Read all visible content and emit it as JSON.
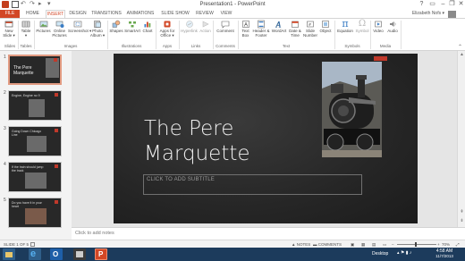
{
  "window": {
    "title": "Presentation1 - PowerPoint",
    "help": "?",
    "minimize": "–",
    "maximize": "❐",
    "close": "✕"
  },
  "quick_access": {
    "undo": "↶",
    "redo": "↷",
    "start": "▸",
    "customize": "▾"
  },
  "tabs": [
    "FILE",
    "HOME",
    "INSERT",
    "DESIGN",
    "TRANSITIONS",
    "ANIMATIONS",
    "SLIDE SHOW",
    "REVIEW",
    "VIEW"
  ],
  "active_tab": "INSERT",
  "user": {
    "name": "Elizabeth Nofs ▾"
  },
  "ribbon": {
    "buttons": {
      "new_slide": "New Slide ▾",
      "table": "Table ▾",
      "pictures": "Pictures",
      "online_pictures": "Online Pictures",
      "screenshot": "Screenshot ▾",
      "photo_album": "Photo Album ▾",
      "shapes": "Shapes",
      "smartart": "SmartArt",
      "chart": "Chart",
      "apps_for_office": "Apps for Office ▾",
      "hyperlink": "Hyperlink",
      "action": "Action",
      "comment": "Comment",
      "text_box": "Text Box",
      "header_footer": "Header & Footer",
      "wordart": "WordArt",
      "date_time": "Date & Time",
      "slide_number": "Slide Number",
      "object": "Object",
      "equation": "Equation",
      "symbol": "Symbol",
      "video": "Video",
      "audio": "Audio"
    },
    "groups": {
      "slides": "Slides",
      "tables": "Tables",
      "images": "Images",
      "illustrations": "Illustrations",
      "apps": "Apps",
      "links": "Links",
      "comments": "Comments",
      "text": "Text",
      "symbols": "Symbols",
      "media": "Media"
    }
  },
  "thumbnails": [
    {
      "num": "1",
      "title": "The Pere Marquette"
    },
    {
      "num": "2",
      "title": "Engine, Engine no 9"
    },
    {
      "num": "3",
      "title": "Going Down Chicago Line"
    },
    {
      "num": "4",
      "title": "If the train should jump the track"
    },
    {
      "num": "5",
      "title": "Do you have it in your heart"
    }
  ],
  "slide": {
    "title_line1": "The Pere",
    "title_line2": "Marquette",
    "subtitle_placeholder": "CLICK TO ADD SUBTITLE"
  },
  "notes": {
    "placeholder": "Click to add notes"
  },
  "status": {
    "slide_count": "SLIDE 1 OF 5",
    "notes": "▲ NOTES",
    "comments": "COMMENTS",
    "zoom_minus": "–",
    "zoom_plus": "+",
    "zoom_level": "70%",
    "fit": "⤢"
  },
  "taskbar": {
    "desktop": "Desktop",
    "time": "4:58 AM",
    "date": "11/7/2013"
  },
  "colors": {
    "accent": "#d24726",
    "slide_bg": "#2c2c2c",
    "slide_red": "#c0392b",
    "taskbar": "#1c3b5c"
  }
}
